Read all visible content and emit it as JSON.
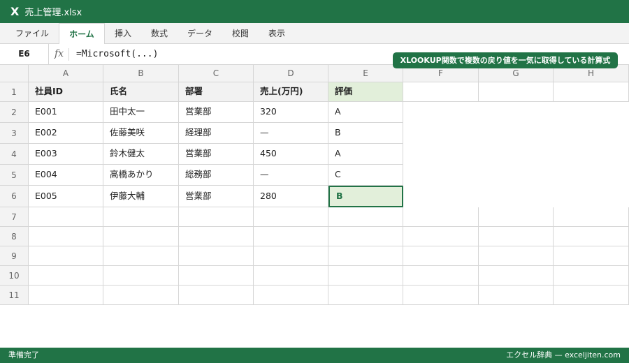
{
  "window": {
    "icon": "excel-icon",
    "icon_glyph": "X",
    "title": "売上管理.xlsx"
  },
  "ribbon": {
    "tabs": [
      "ファイル",
      "ホーム",
      "挿入",
      "数式",
      "データ",
      "校閲",
      "表示"
    ],
    "active_tab": "ホーム"
  },
  "formula_bar": {
    "name_box": "E6",
    "fx_label": "fx",
    "formula": "=Microsoft(...)"
  },
  "banner": {
    "text": "XLOOKUP関数で複数の戻り値を一気に取得している計算式"
  },
  "sheet": {
    "columns": [
      "A",
      "B",
      "C",
      "D",
      "E",
      "F",
      "G",
      "H"
    ],
    "row_numbers": [
      "1",
      "2",
      "3",
      "4",
      "5",
      "6",
      "7",
      "8",
      "9",
      "10",
      "11"
    ],
    "header": [
      "社員ID",
      "氏名",
      "部署",
      "売上(万円)",
      "評価"
    ],
    "rows": [
      [
        "E001",
        "田中太一",
        "営業部",
        "320",
        "A"
      ],
      [
        "E002",
        "佐藤美咲",
        "経理部",
        "—",
        "B"
      ],
      [
        "E003",
        "鈴木健太",
        "営業部",
        "450",
        "A"
      ],
      [
        "E004",
        "高橋あかり",
        "総務部",
        "—",
        "C"
      ],
      [
        "E005",
        "伊藤大輔",
        "営業部",
        "280",
        "B"
      ]
    ],
    "selected_cell": "E6"
  },
  "status": {
    "left": "準備完了",
    "right": "エクセル辞典 — exceljiten.com"
  },
  "colors": {
    "accent": "#217346",
    "highlight": "#e2efda",
    "gridline": "#d6d6d6",
    "header_bg": "#f3f3f3"
  }
}
